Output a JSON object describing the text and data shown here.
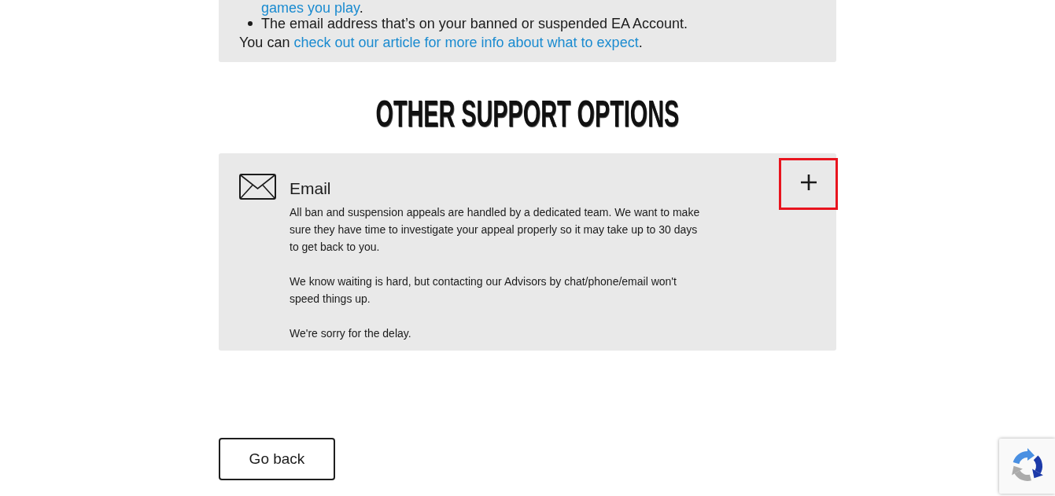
{
  "notice": {
    "list_items": [
      {
        "continued": true,
        "link": "games you play",
        "text": "."
      },
      {
        "continued": false,
        "text": "The email address that’s on your banned or suspended EA Account."
      }
    ],
    "footer": {
      "before": "You can ",
      "link": "check out our article for more info about what to expect",
      "after": "."
    }
  },
  "support": {
    "heading": "OTHER SUPPORT OPTIONS",
    "options": [
      {
        "title": "Email",
        "paragraphs": [
          "All ban and suspension appeals are handled by a dedicated team. We want to make sure they have time to investigate your appeal properly so it may take up to 30 days to get back to you.",
          "We know waiting is hard, but contacting our Advisors by chat/phone/email won't speed things up.",
          "We're sorry for the delay."
        ],
        "expand_button": {
          "highlighted": true
        }
      }
    ]
  },
  "back_button": "Go back"
}
